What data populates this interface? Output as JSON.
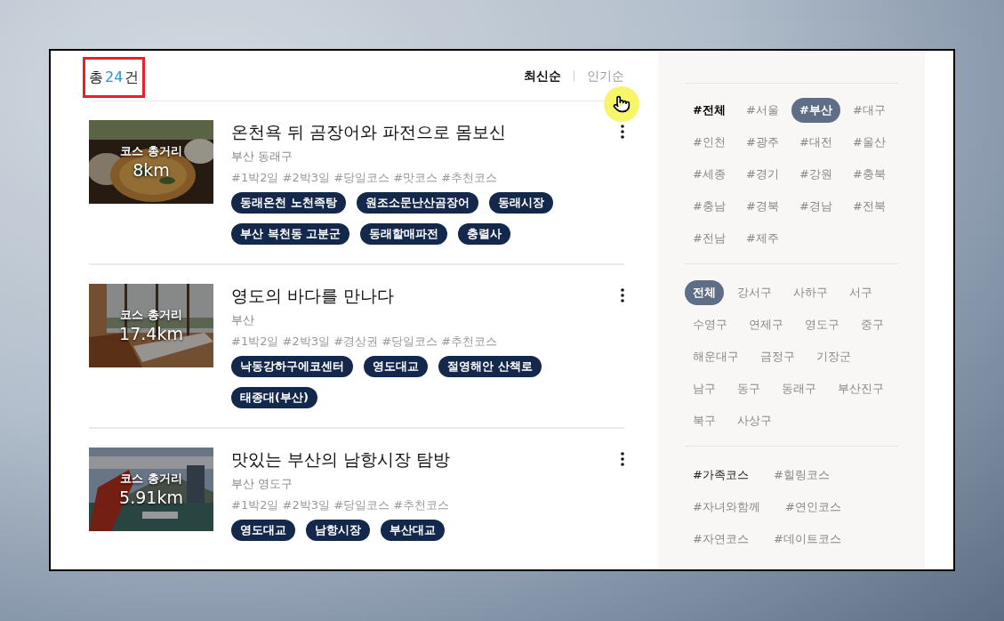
{
  "result": {
    "prefix": "총",
    "count": "24",
    "suffix": "건"
  },
  "sort": [
    {
      "label": "최신순",
      "selected": true
    },
    {
      "label": "인기순",
      "selected": false
    }
  ],
  "courses": [
    {
      "title": "온천욕 뒤 곰장어와 파전으로 몸보신",
      "location": "부산 동래구",
      "hashtags": "#1박2일 #2박3일 #당일코스 #맛코스 #추천코스",
      "distance_label": "코스 총거리",
      "distance": "8km",
      "places": [
        "동래온천 노천족탕",
        "원조소문난산곰장어",
        "동래시장",
        "부산 복천동 고분군",
        "동래할매파전",
        "충렬사"
      ]
    },
    {
      "title": "영도의 바다를 만나다",
      "location": "부산",
      "hashtags": "#1박2일 #2박3일 #경상권 #당일코스 #추천코스",
      "distance_label": "코스 총거리",
      "distance": "17.4km",
      "places": [
        "낙동강하구에코센터",
        "영도대교",
        "절영해안 산책로",
        "태종대(부산)"
      ]
    },
    {
      "title": "맛있는 부산의 남항시장 탐방",
      "location": "부산 영도구",
      "hashtags": "#1박2일 #2박3일 #당일코스 #추천코스",
      "distance_label": "코스 총거리",
      "distance": "5.91km",
      "places": [
        "영도대교",
        "남항시장",
        "부산대교"
      ]
    }
  ],
  "sidebar": {
    "regions": [
      {
        "label": "#전체",
        "selected": false,
        "bold": true
      },
      {
        "label": "#서울",
        "selected": false,
        "bold": false
      },
      {
        "label": "#부산",
        "selected": true,
        "bold": false
      },
      {
        "label": "#대구",
        "selected": false,
        "bold": false
      },
      {
        "label": "#인천",
        "selected": false,
        "bold": false
      },
      {
        "label": "#광주",
        "selected": false,
        "bold": false
      },
      {
        "label": "#대전",
        "selected": false,
        "bold": false
      },
      {
        "label": "#울산",
        "selected": false,
        "bold": false
      },
      {
        "label": "#세종",
        "selected": false,
        "bold": false
      },
      {
        "label": "#경기",
        "selected": false,
        "bold": false
      },
      {
        "label": "#강원",
        "selected": false,
        "bold": false
      },
      {
        "label": "#충북",
        "selected": false,
        "bold": false
      },
      {
        "label": "#충남",
        "selected": false,
        "bold": false
      },
      {
        "label": "#경북",
        "selected": false,
        "bold": false
      },
      {
        "label": "#경남",
        "selected": false,
        "bold": false
      },
      {
        "label": "#전북",
        "selected": false,
        "bold": false
      },
      {
        "label": "#전남",
        "selected": false,
        "bold": false
      },
      {
        "label": "#제주",
        "selected": false,
        "bold": false
      }
    ],
    "districts": [
      {
        "label": "전체",
        "selected": true
      },
      {
        "label": "강서구",
        "selected": false
      },
      {
        "label": "사하구",
        "selected": false
      },
      {
        "label": "서구",
        "selected": false
      },
      {
        "label": "수영구",
        "selected": false
      },
      {
        "label": "연제구",
        "selected": false
      },
      {
        "label": "영도구",
        "selected": false
      },
      {
        "label": "중구",
        "selected": false
      },
      {
        "label": "해운대구",
        "selected": false
      },
      {
        "label": "금정구",
        "selected": false
      },
      {
        "label": "기장군",
        "selected": false
      },
      {
        "label": "남구",
        "selected": false
      },
      {
        "label": "동구",
        "selected": false
      },
      {
        "label": "동래구",
        "selected": false
      },
      {
        "label": "부산진구",
        "selected": false
      },
      {
        "label": "북구",
        "selected": false
      },
      {
        "label": "사상구",
        "selected": false
      }
    ],
    "themes": [
      {
        "label": "#가족코스",
        "active": true
      },
      {
        "label": "#힐링코스",
        "active": false
      },
      {
        "label": "#자녀와함께",
        "active": false
      },
      {
        "label": "#연인코스",
        "active": false
      },
      {
        "label": "#자연코스",
        "active": false
      },
      {
        "label": "#데이트코스",
        "active": false
      }
    ]
  }
}
